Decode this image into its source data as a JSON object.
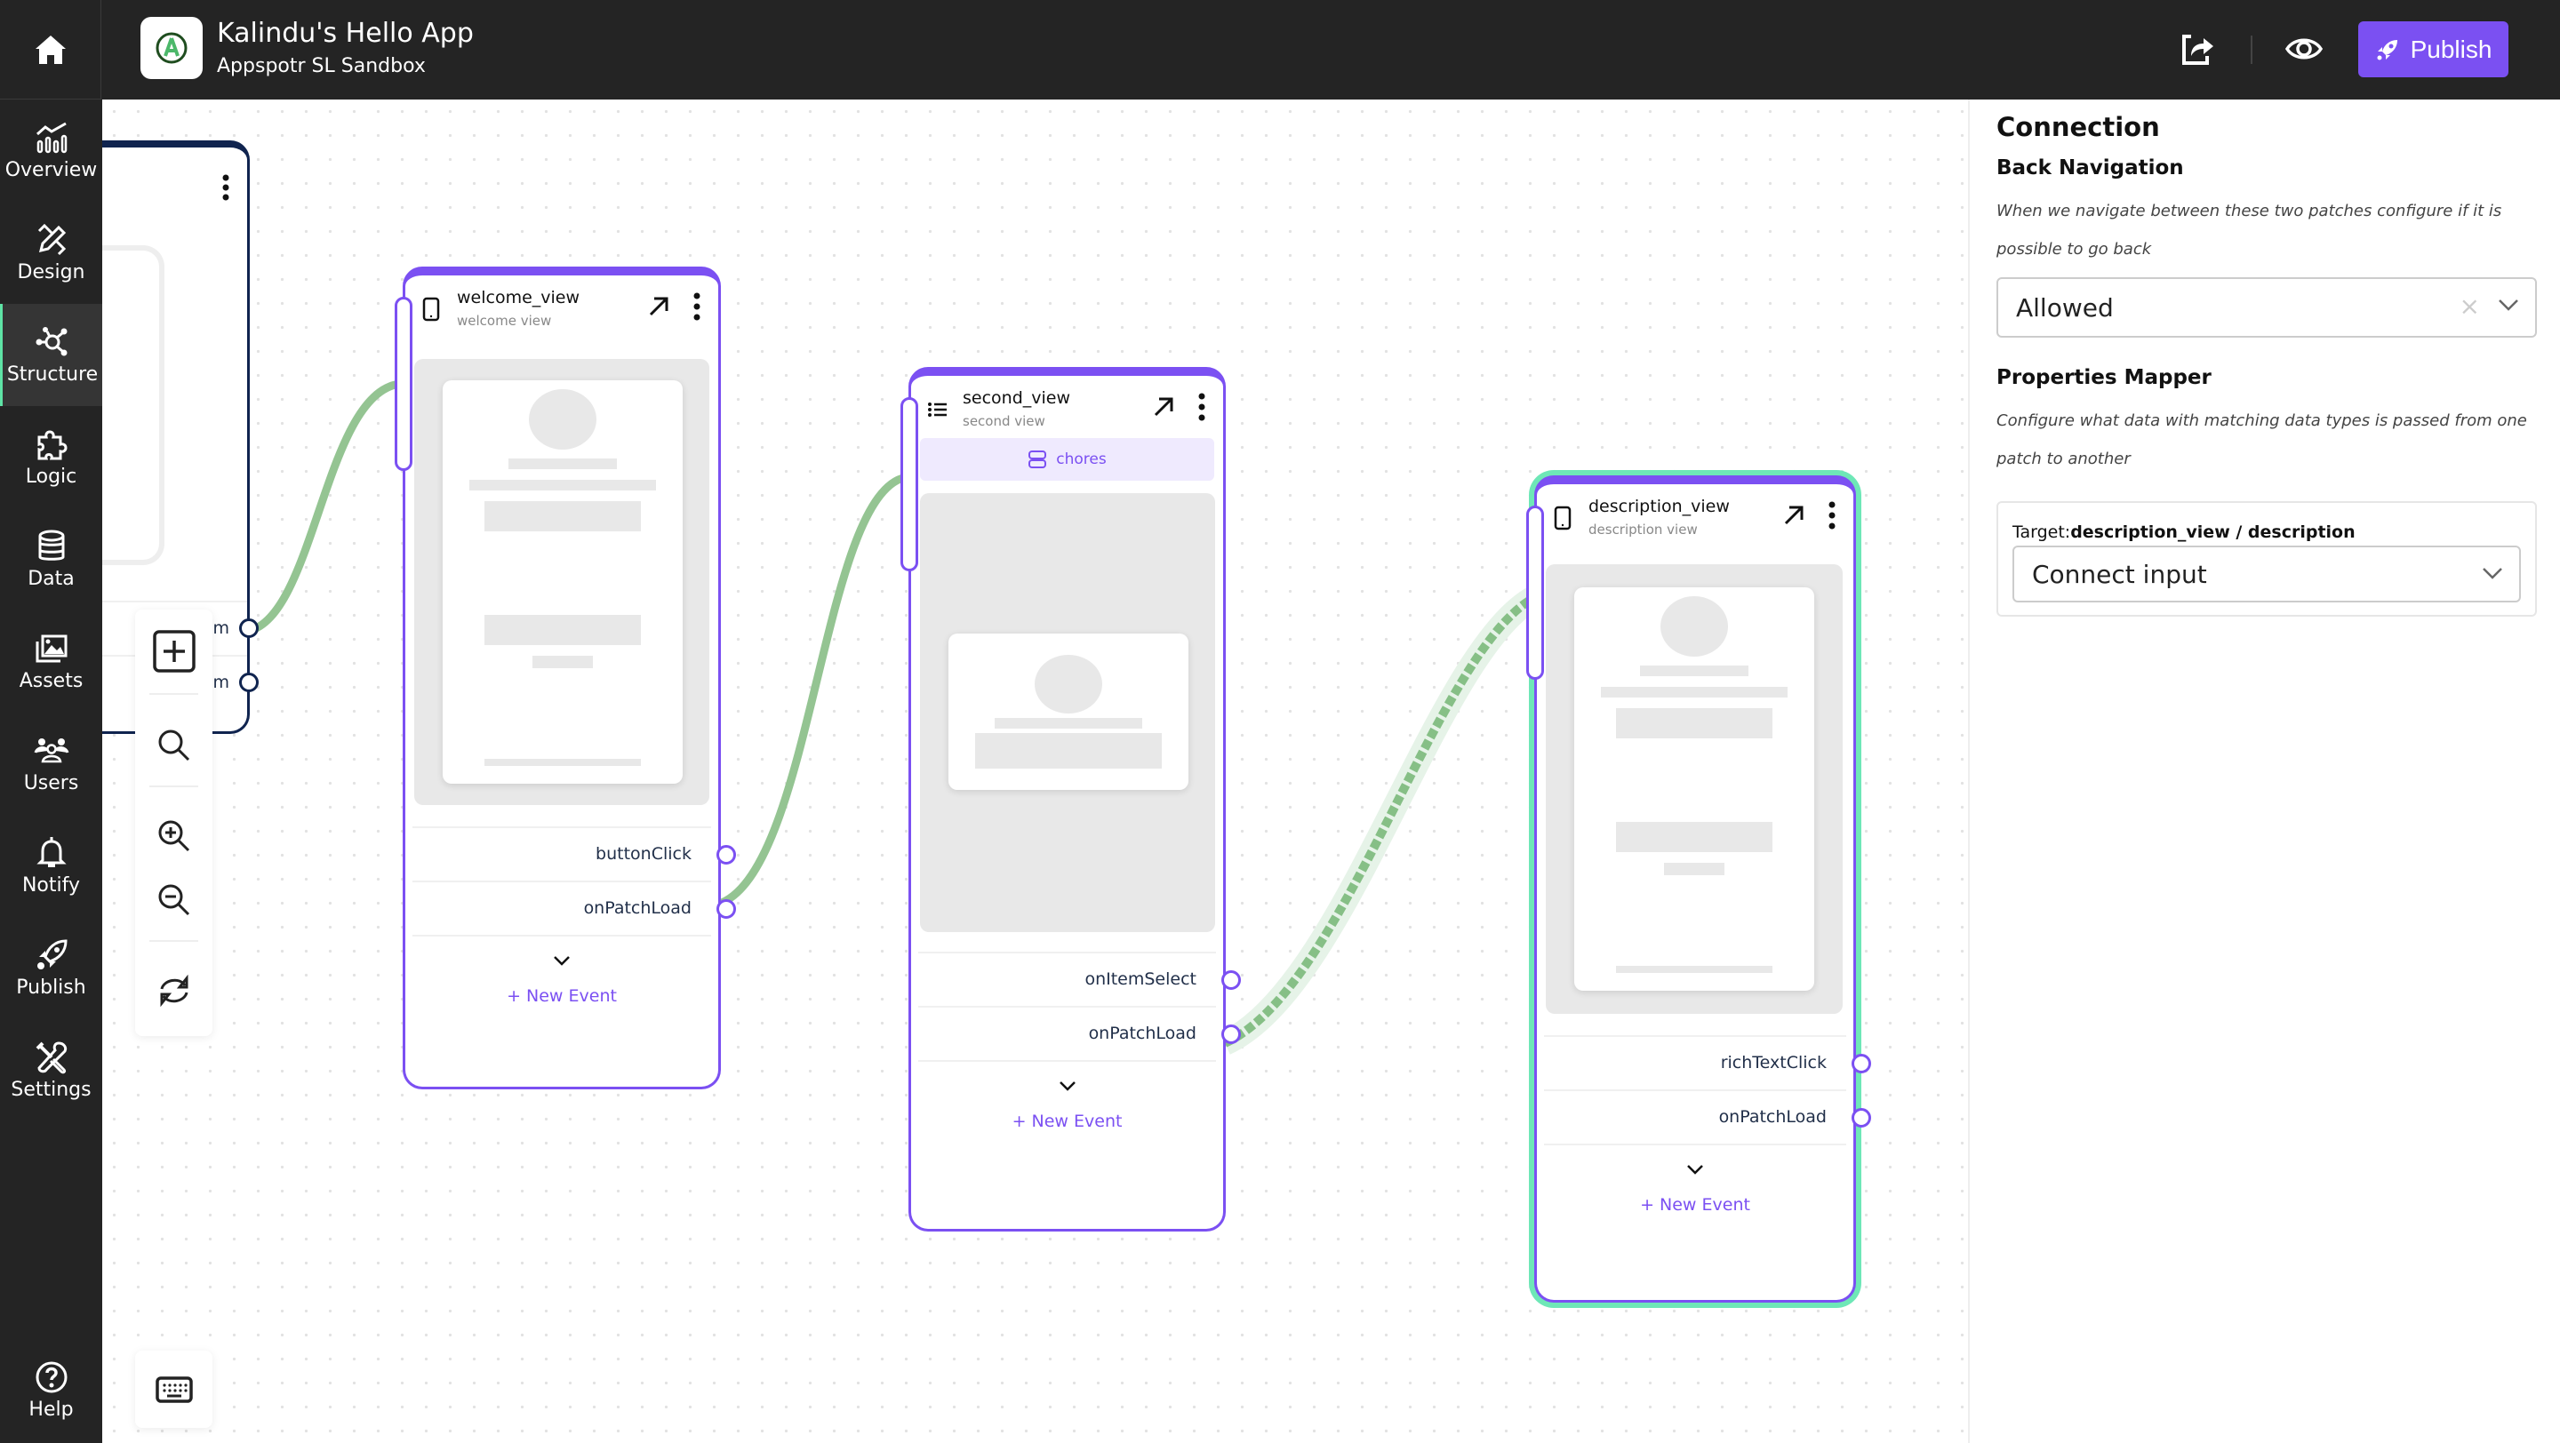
{
  "header": {
    "app_title": "Kalindu's Hello App",
    "app_subtitle": "Appspotr SL Sandbox",
    "icons": {
      "home": "home-icon",
      "share": "share-icon",
      "preview": "eye-icon",
      "logo": "appspotr-logo-icon"
    },
    "publish_label": "Publish",
    "accent_color": "#7b50f2"
  },
  "sidebar": {
    "items": [
      {
        "label": "Overview",
        "icon": "chart-icon"
      },
      {
        "label": "Design",
        "icon": "pencil-ruler-icon"
      },
      {
        "label": "Structure",
        "icon": "network-icon",
        "active": true
      },
      {
        "label": "Logic",
        "icon": "puzzle-icon"
      },
      {
        "label": "Data",
        "icon": "database-icon"
      },
      {
        "label": "Assets",
        "icon": "images-icon"
      },
      {
        "label": "Users",
        "icon": "users-icon"
      },
      {
        "label": "Notify",
        "icon": "bell-icon"
      },
      {
        "label": "Publish",
        "icon": "rocket-icon"
      },
      {
        "label": "Settings",
        "icon": "tools-icon"
      }
    ],
    "help_label": "Help"
  },
  "canvas": {
    "left_node": {
      "events": [
        "m",
        "m"
      ]
    },
    "nodes": [
      {
        "id": "welcome_view",
        "title": "welcome_view",
        "subtitle": "welcome view",
        "type_icon": "phone-icon",
        "events": [
          "buttonClick",
          "onPatchLoad"
        ],
        "new_event_label": "+ New Event"
      },
      {
        "id": "second_view",
        "title": "second_view",
        "subtitle": "second view",
        "type_icon": "list-icon",
        "data_source": "chores",
        "events": [
          "onItemSelect",
          "onPatchLoad"
        ],
        "new_event_label": "+ New Event"
      },
      {
        "id": "description_view",
        "title": "description_view",
        "subtitle": "description view",
        "type_icon": "phone-icon",
        "selected": true,
        "events": [
          "richTextClick",
          "onPatchLoad"
        ],
        "new_event_label": "+ New Event"
      }
    ],
    "connections": [
      {
        "from": "left_node.event_0",
        "to": "welcome_view",
        "style": "solid"
      },
      {
        "from": "welcome_view.buttonClick",
        "to": "second_view",
        "style": "solid"
      },
      {
        "from": "second_view.onItemSelect",
        "to": "description_view",
        "style": "dashed-selected"
      }
    ],
    "toolbar": [
      "add-node-icon",
      "search-icon",
      "zoom-in-icon",
      "zoom-out-icon",
      "refresh-icon"
    ],
    "keyboard_icon": "keyboard-icon"
  },
  "panel": {
    "title": "Connection",
    "back_nav": {
      "heading": "Back Navigation",
      "description": "When we navigate between these two patches configure if it is possible to go back",
      "value": "Allowed",
      "clear_symbol": "×"
    },
    "mapper": {
      "heading": "Properties Mapper",
      "description": "Configure what data with matching data types is passed from one patch to another",
      "target_prefix": "Target:",
      "target_value": "description_view / description",
      "select_value": "Connect input"
    }
  }
}
